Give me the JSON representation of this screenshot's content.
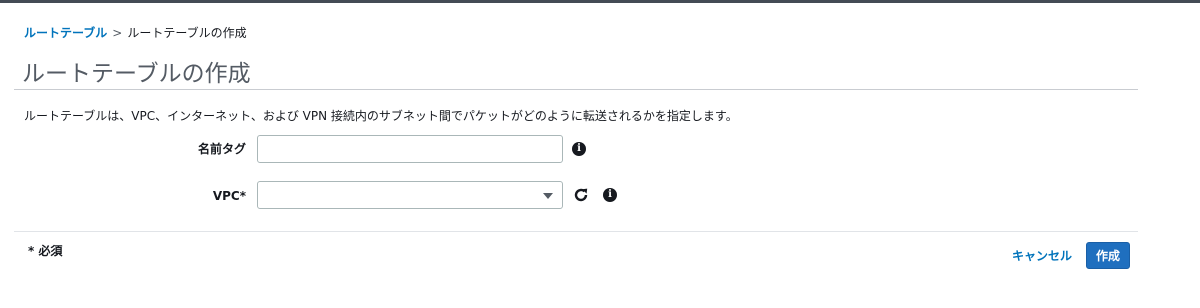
{
  "breadcrumb": {
    "parent": "ルートテーブル",
    "separator": ">",
    "current": "ルートテーブルの作成"
  },
  "page": {
    "title": "ルートテーブルの作成",
    "description": "ルートテーブルは、VPC、インターネット、および VPN 接続内のサブネット間でパケットがどのように転送されるかを指定します。"
  },
  "form": {
    "name_tag": {
      "label": "名前タグ",
      "value": "",
      "placeholder": ""
    },
    "vpc": {
      "label": "VPC*",
      "selected": ""
    },
    "icons": {
      "info": "info-icon",
      "refresh": "refresh-icon",
      "dropdown": "chevron-down-icon"
    }
  },
  "footer": {
    "required_note": "* 必須",
    "cancel_label": "キャンセル",
    "create_label": "作成"
  },
  "colors": {
    "link": "#0073bb",
    "primary_button": "#1f6fbf",
    "title_text": "#545b64"
  }
}
